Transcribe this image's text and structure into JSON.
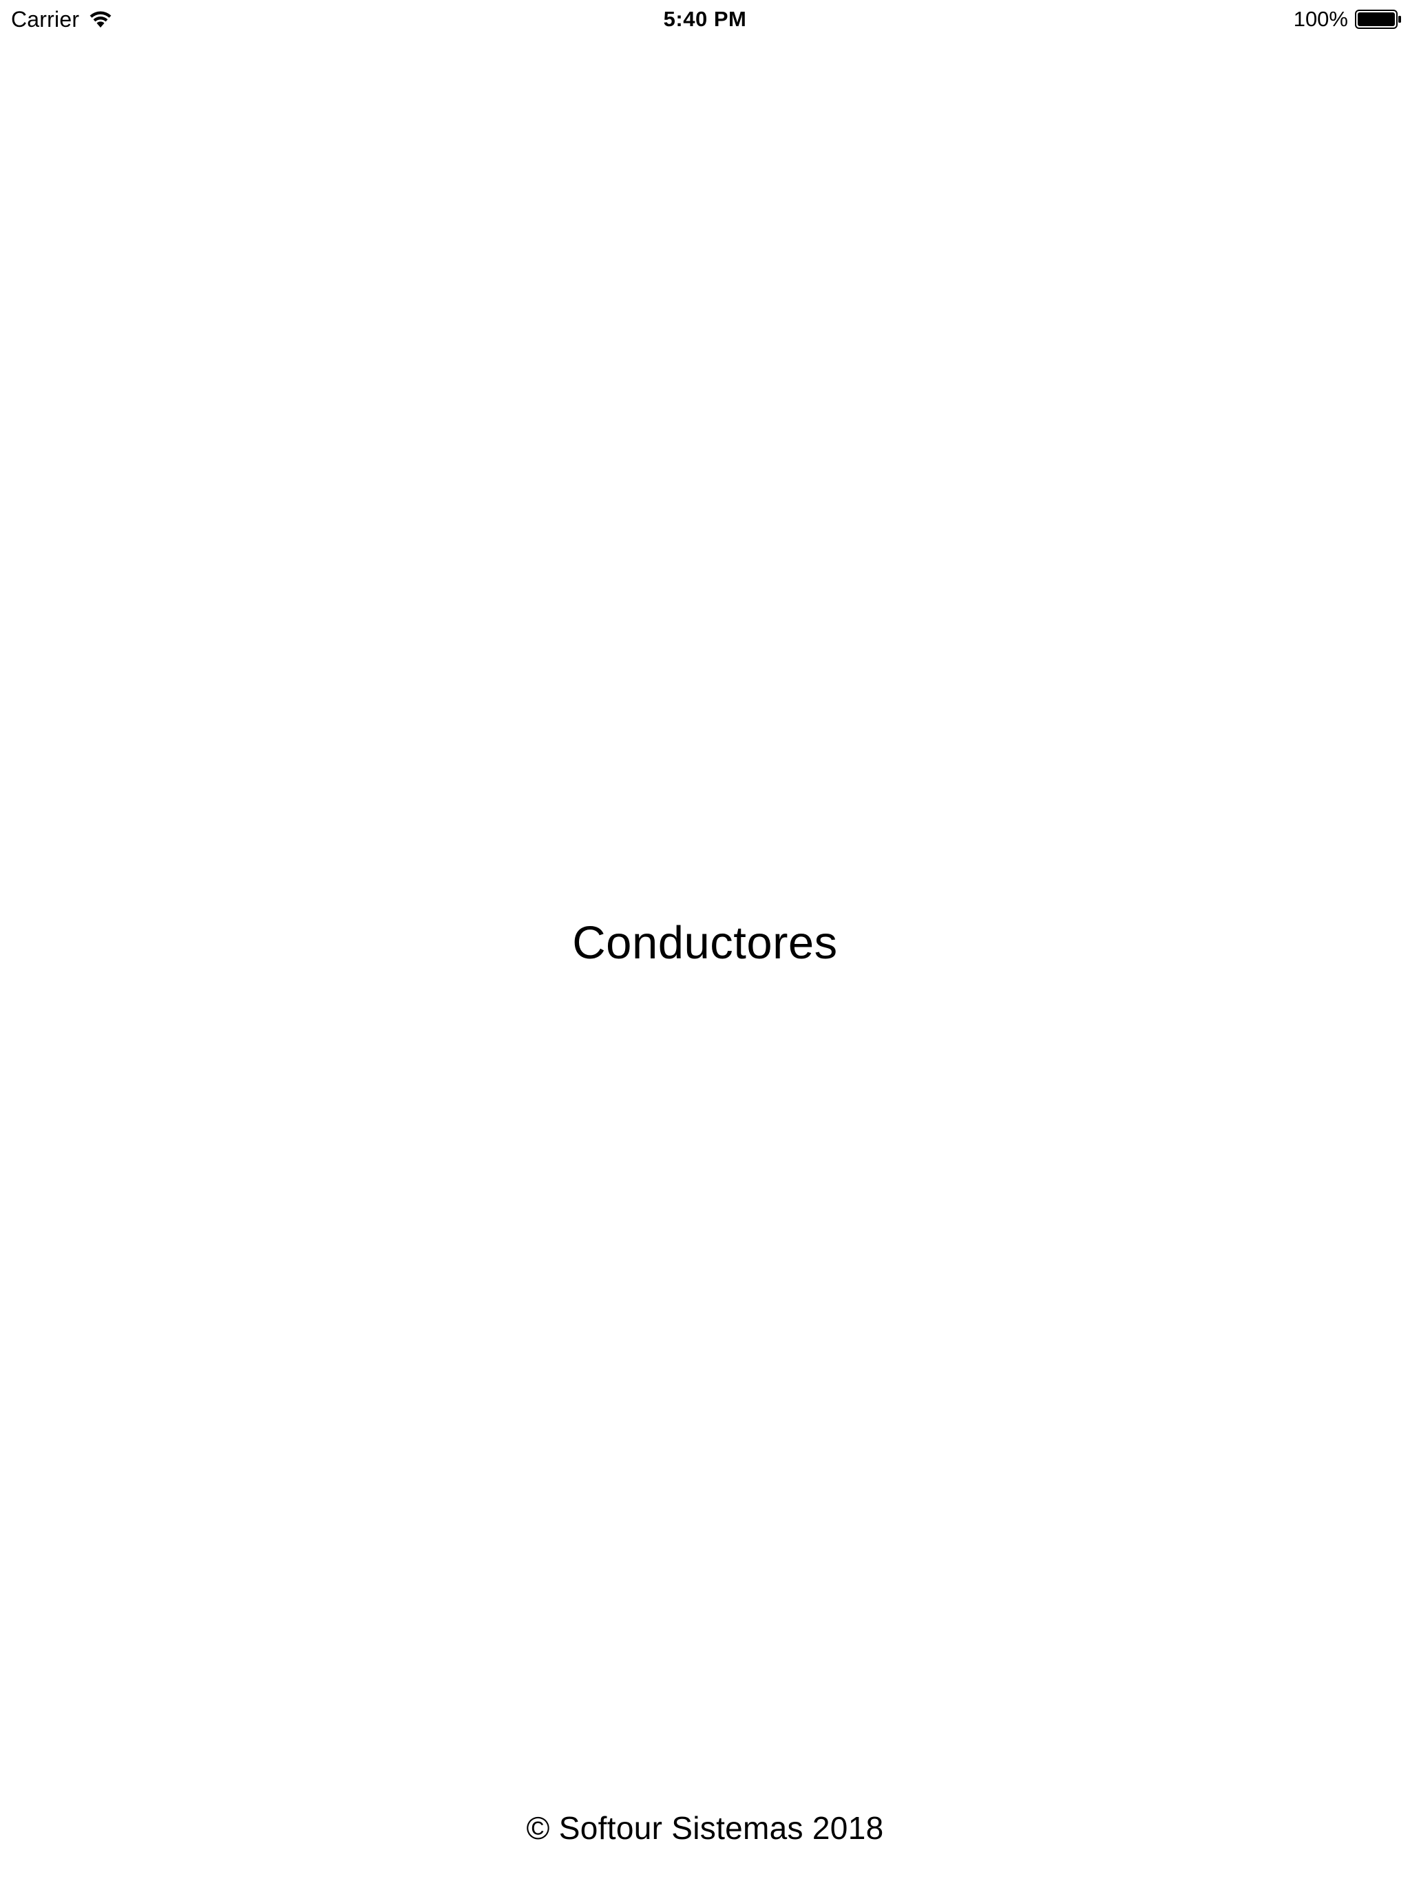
{
  "status_bar": {
    "carrier": "Carrier",
    "wifi_icon": "wifi-icon",
    "time": "5:40 PM",
    "battery_percent": "100%",
    "battery_icon": "battery-full-icon",
    "battery_level": 1.0
  },
  "launch_screen": {
    "title": "Conductores",
    "copyright": "© Softour Sistemas 2018"
  },
  "colors": {
    "background": "#ffffff",
    "text": "#000000"
  }
}
